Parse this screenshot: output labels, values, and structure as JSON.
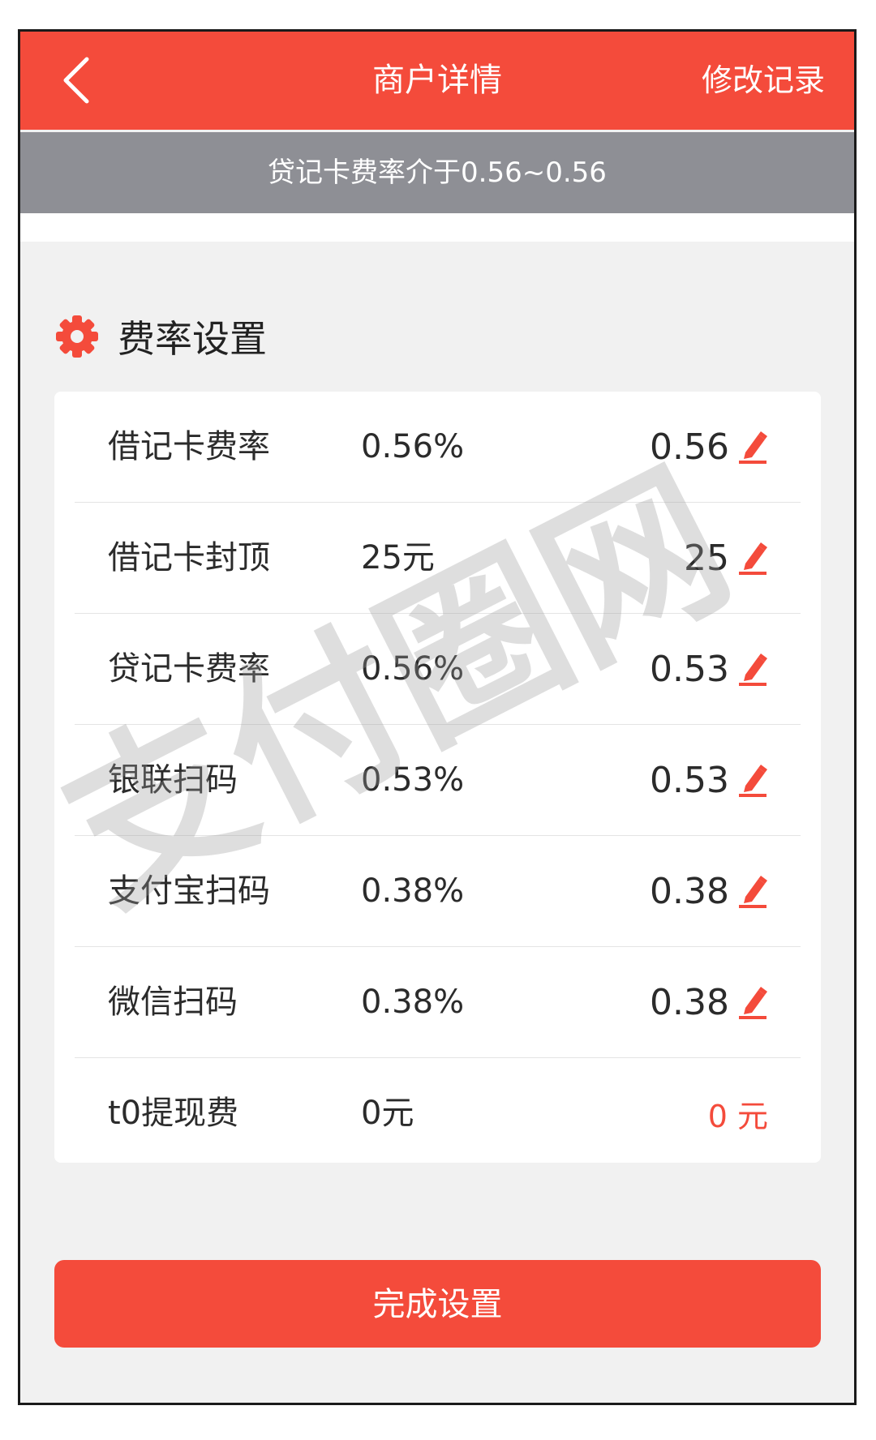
{
  "header": {
    "title": "商户详情",
    "right_action": "修改记录",
    "back_icon": "chevron-left-icon"
  },
  "notice": "贷记卡费率介于0.56~0.56",
  "section": {
    "title": "费率设置",
    "icon": "gear-icon"
  },
  "rates": [
    {
      "label": "借记卡费率",
      "current": "0.56%",
      "value": "0.56",
      "editable": true
    },
    {
      "label": "借记卡封顶",
      "current": "25元",
      "value": "25",
      "editable": true
    },
    {
      "label": "贷记卡费率",
      "current": "0.56%",
      "value": "0.53",
      "editable": true
    },
    {
      "label": "银联扫码",
      "current": "0.53%",
      "value": "0.53",
      "editable": true
    },
    {
      "label": "支付宝扫码",
      "current": "0.38%",
      "value": "0.38",
      "editable": true
    },
    {
      "label": "微信扫码",
      "current": "0.38%",
      "value": "0.38",
      "editable": true
    },
    {
      "label": "t0提现费",
      "current": "0元",
      "value": "0 元",
      "editable": false
    }
  ],
  "submit_label": "完成设置",
  "watermark": "支付圈网",
  "colors": {
    "accent": "#f44b3b",
    "notice_bg": "#8e8f95",
    "page_bg": "#f1f1f1"
  }
}
